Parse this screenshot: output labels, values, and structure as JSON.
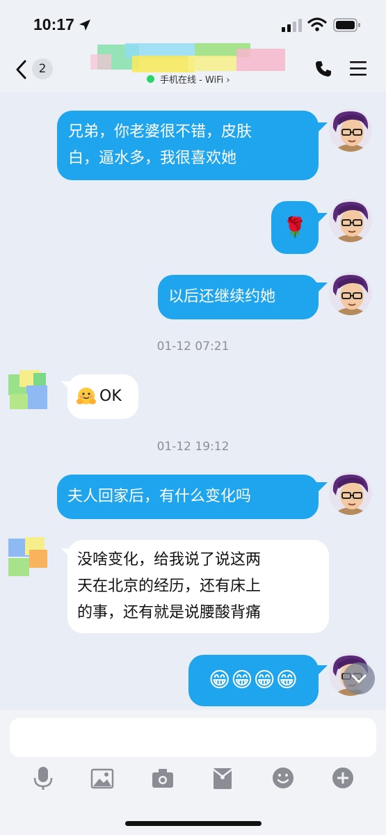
{
  "status_bar": {
    "time": "10:17"
  },
  "header": {
    "back_count": "2",
    "status": "手机在线 - WiFi ›"
  },
  "messages": [
    {
      "side": "out",
      "text": "兄弟，你老婆很不错，皮肤\n白，逼水多，我很喜欢她"
    },
    {
      "side": "out",
      "text": "🌹"
    },
    {
      "side": "out",
      "text": "以后还继续约她"
    },
    {
      "timestamp": "01-12 07:21"
    },
    {
      "side": "in",
      "text": "OK"
    },
    {
      "timestamp": "01-12 19:12"
    },
    {
      "side": "out",
      "text": "夫人回家后，有什么变化吗"
    },
    {
      "side": "in",
      "text": "没啥变化，给我说了说这两\n天在北京的经历，还有床上\n的事，还有就是说腰酸背痛"
    },
    {
      "side": "out",
      "text": "😁😁😁😁"
    }
  ],
  "toolbar": [
    "mic-icon",
    "image-icon",
    "camera-icon",
    "red-packet-icon",
    "emoji-icon",
    "plus-icon"
  ],
  "colors": {
    "outgoing_bubble": "#1fa5ee",
    "incoming_bubble": "#ffffff",
    "background": "#e9edf5"
  }
}
